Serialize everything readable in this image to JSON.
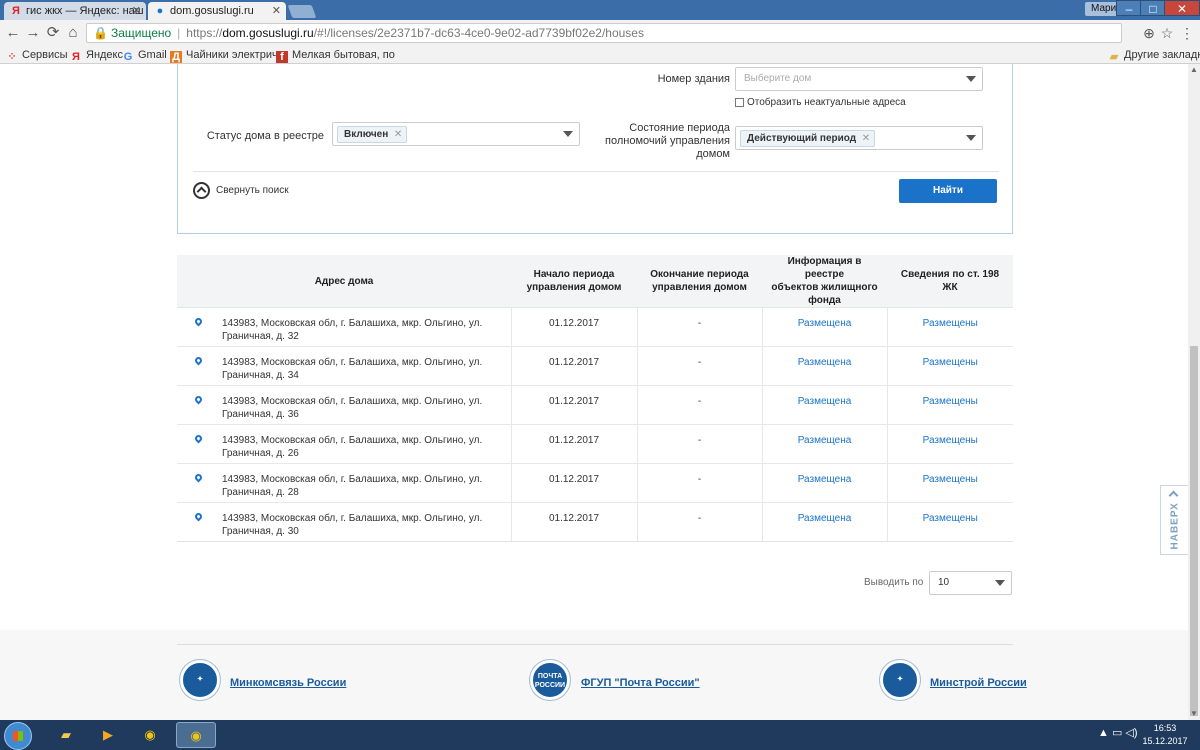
{
  "browser": {
    "tabs": [
      {
        "title": "гис жкх — Яндекс: наш",
        "favicon": "Я"
      },
      {
        "title": "dom.gosuslugi.ru",
        "favicon": "●"
      }
    ],
    "user": "Мария",
    "window_controls": {
      "minimize": "–",
      "maximize": "□",
      "close": "✕"
    },
    "address": {
      "security_label": "Защищено",
      "scheme": "https://",
      "host": "dom.gosuslugi.ru",
      "path": "/#!/licenses/2e2371b7-dc63-4ce0-9e02-ad7739bf02e2/houses"
    },
    "bookmarks": [
      {
        "label": "Сервисы",
        "icon": "apps-icon"
      },
      {
        "label": "Яндекс",
        "icon": "Я"
      },
      {
        "label": "Gmail",
        "icon": "G"
      },
      {
        "label": "Чайники электриче",
        "icon": "Д"
      },
      {
        "label": "Мелкая бытовая, по",
        "icon": "f"
      }
    ],
    "other_bookmarks": "Другие закладки"
  },
  "filters": {
    "building_number_label": "Номер здания",
    "building_number_placeholder": "Выберите дом",
    "show_inactive_label": "Отобразить неактуальные адреса",
    "registry_status_label": "Статус дома в реестре",
    "registry_status_value": "Включен",
    "period_state_label_1": "Состояние периода",
    "period_state_label_2": "полномочий управления",
    "period_state_label_3": "домом",
    "period_state_value": "Действующий период",
    "collapse_label": "Свернуть поиск",
    "find_button": "Найти"
  },
  "table": {
    "headers": {
      "address": "Адрес дома",
      "start_1": "Начало периода",
      "start_2": "управления домом",
      "end_1": "Окончание периода",
      "end_2": "управления домом",
      "info_1": "Информация в реестре",
      "info_2": "объектов жилищного",
      "info_3": "фонда",
      "art198": "Сведения по ст. 198 ЖК"
    },
    "rows": [
      {
        "address": "143983, Московская обл, г. Балашиха, мкр. Ольгино, ул. Граничная, д. 32",
        "start": "01.12.2017",
        "end": "-",
        "info": "Размещена",
        "art198": "Размещены"
      },
      {
        "address": "143983, Московская обл, г. Балашиха, мкр. Ольгино, ул. Граничная, д. 34",
        "start": "01.12.2017",
        "end": "-",
        "info": "Размещена",
        "art198": "Размещены"
      },
      {
        "address": "143983, Московская обл, г. Балашиха, мкр. Ольгино, ул. Граничная, д. 36",
        "start": "01.12.2017",
        "end": "-",
        "info": "Размещена",
        "art198": "Размещены"
      },
      {
        "address": "143983, Московская обл, г. Балашиха, мкр. Ольгино, ул. Граничная, д. 26",
        "start": "01.12.2017",
        "end": "-",
        "info": "Размещена",
        "art198": "Размещены"
      },
      {
        "address": "143983, Московская обл, г. Балашиха, мкр. Ольгино, ул. Граничная, д. 28",
        "start": "01.12.2017",
        "end": "-",
        "info": "Размещена",
        "art198": "Размещены"
      },
      {
        "address": "143983, Московская обл, г. Балашиха, мкр. Ольгино, ул. Граничная, д. 30",
        "start": "01.12.2017",
        "end": "-",
        "info": "Размещена",
        "art198": "Размещены"
      }
    ]
  },
  "pagination": {
    "label": "Выводить по",
    "value": "10"
  },
  "scroll_top": "НАВЕРХ",
  "footer": {
    "links": [
      {
        "label": "Минкомсвязь России"
      },
      {
        "label": "ФГУП \"Почта России\"",
        "emblem_text_1": "ПОЧТА",
        "emblem_text_2": "РОССИИ"
      },
      {
        "label": "Минстрой России"
      }
    ]
  },
  "taskbar": {
    "time": "16:53",
    "date": "15.12.2017"
  },
  "colors": {
    "accent": "#1a73c9",
    "chrome_frame": "#3b6ea8",
    "taskbar": "#1f3a5c"
  }
}
